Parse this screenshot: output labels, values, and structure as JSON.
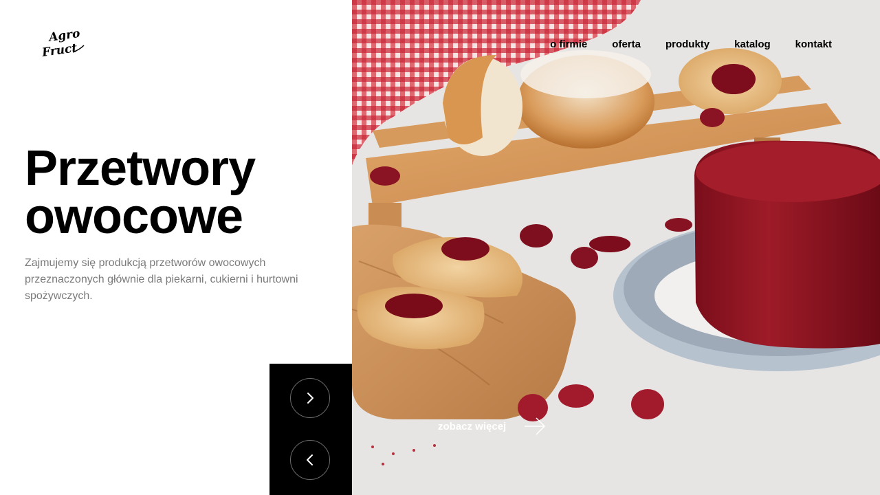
{
  "brand": {
    "logo_text": "Agro Fruct"
  },
  "nav": {
    "items": [
      "o firmie",
      "oferta",
      "produkty",
      "katalog",
      "kontakt"
    ]
  },
  "hero": {
    "title_line1": "Przetwory",
    "title_line2": "owocowe",
    "description": "Zajmujemy się produkcją przetworów owocowych przeznaczonych głównie dla piekarni, cukierni i hurtowni spożywczych.",
    "cta_label": "zobacz więcej",
    "image": "photo of jam pastries, donuts on a wooden board and a red fruit jelly on a plate"
  },
  "slider": {
    "next_icon": "chevron-right-icon",
    "prev_icon": "chevron-left-icon"
  },
  "colors": {
    "text": "#000000",
    "muted": "#7a7a7a",
    "dark_panel": "#000000",
    "accent_jelly": "#8c1420"
  }
}
